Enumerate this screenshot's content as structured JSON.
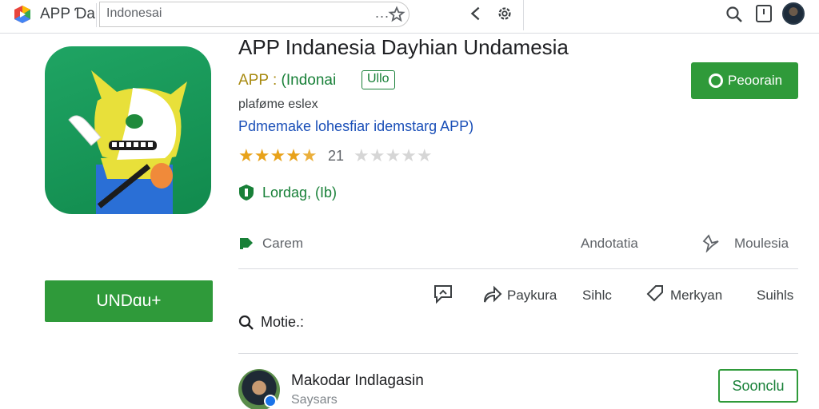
{
  "topbar": {
    "app_title": "APP Ɗa",
    "search_value": "Indonesai",
    "search_dots": "..."
  },
  "app": {
    "name": "APP Indanesia Dayhian Undamesia",
    "developer": "APP",
    "developer_sep": ":",
    "developer_name": "(Indonai",
    "badge": "Ullo",
    "category": "plaføme eslex",
    "tagline": "Pdmemake lohesfiar idemstarg APP)",
    "rating_count": "21",
    "rating_value": 4.5,
    "loading_text": "Lordag, (Ib)"
  },
  "buttons": {
    "install": "Peoorain",
    "undu": "UNDɑu+",
    "follow": "Soonclu"
  },
  "row1": {
    "caremi": "Carem",
    "annotation": "Andotatia",
    "share": "Moulesia"
  },
  "row2": {
    "pay": "Paykura",
    "sihlc": "Sihlc",
    "merk": "Merkyan",
    "suihls": "Suihls"
  },
  "more": {
    "label": "Motie.:"
  },
  "reviewer": {
    "name": "Makodar Indlagasin",
    "sub": "Saysars"
  },
  "colors": {
    "brand_green": "#2f9a3a",
    "star": "#e8a21a",
    "link_blue": "#1a4fb8"
  }
}
